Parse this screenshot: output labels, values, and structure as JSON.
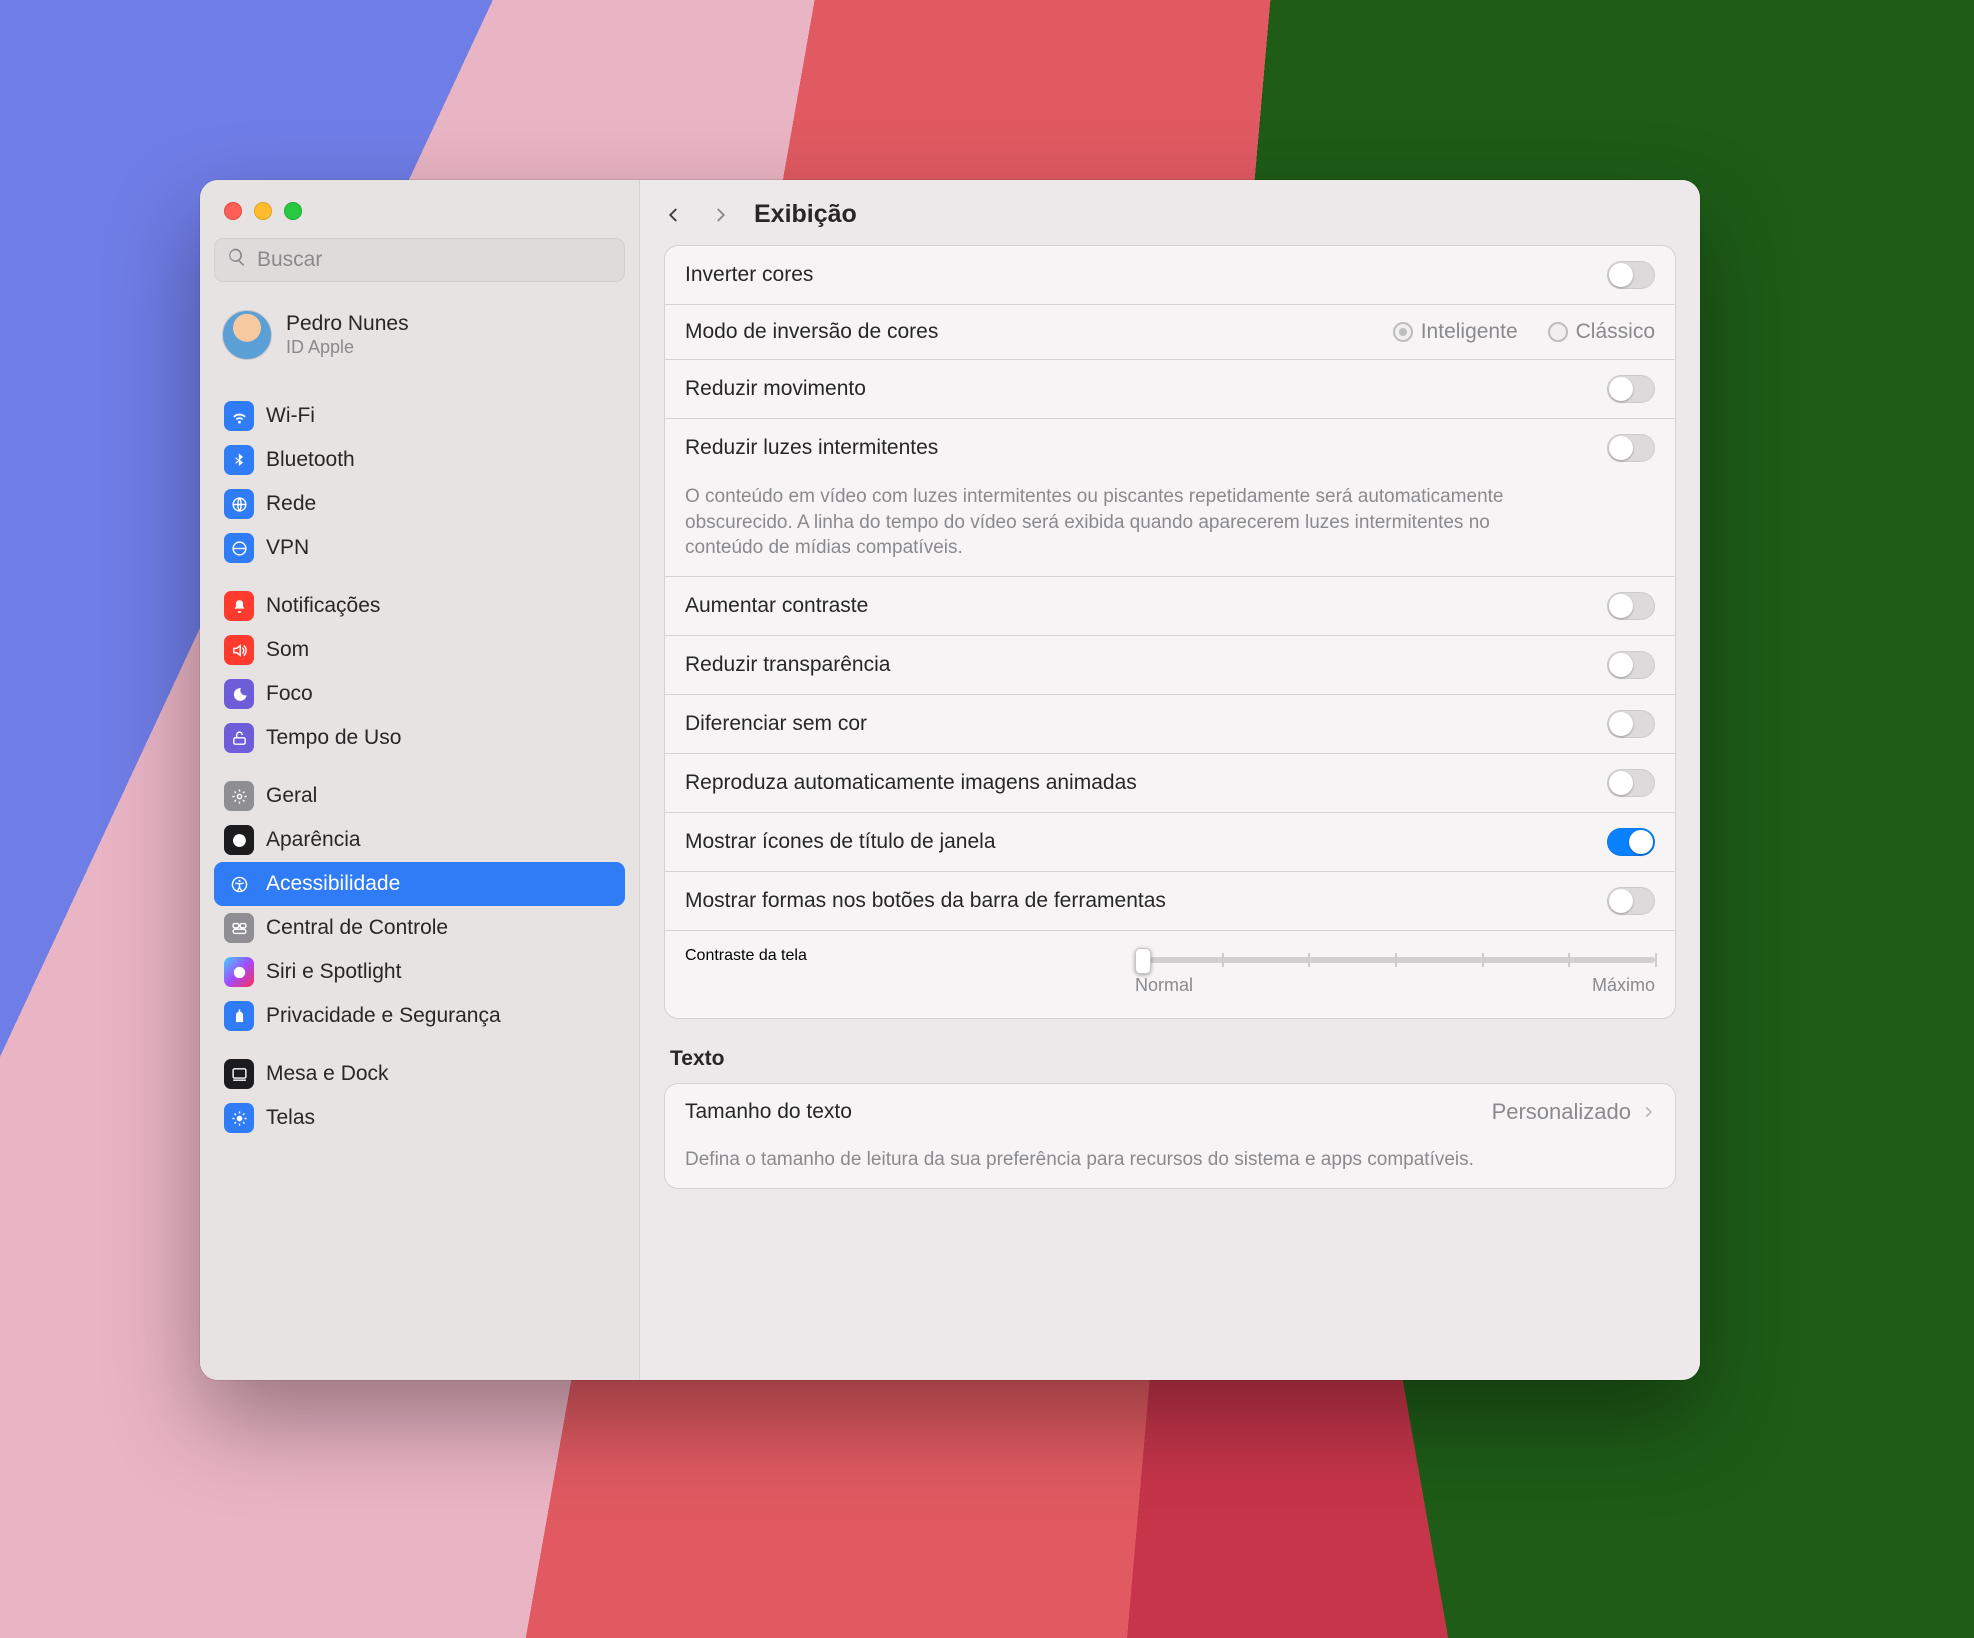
{
  "window": {
    "title": "Exibição"
  },
  "search": {
    "placeholder": "Buscar"
  },
  "user": {
    "name": "Pedro Nunes",
    "sub": "ID Apple"
  },
  "sidebar": {
    "groups": [
      [
        {
          "id": "wifi",
          "label": "Wi-Fi"
        },
        {
          "id": "bluetooth",
          "label": "Bluetooth"
        },
        {
          "id": "network",
          "label": "Rede"
        },
        {
          "id": "vpn",
          "label": "VPN"
        }
      ],
      [
        {
          "id": "notifications",
          "label": "Notificações"
        },
        {
          "id": "sound",
          "label": "Som"
        },
        {
          "id": "focus",
          "label": "Foco"
        },
        {
          "id": "screentime",
          "label": "Tempo de Uso"
        }
      ],
      [
        {
          "id": "general",
          "label": "Geral"
        },
        {
          "id": "appearance",
          "label": "Aparência"
        },
        {
          "id": "accessibility",
          "label": "Acessibilidade",
          "selected": true
        },
        {
          "id": "controlcenter",
          "label": "Central de Controle"
        },
        {
          "id": "siri",
          "label": "Siri e Spotlight"
        },
        {
          "id": "privacy",
          "label": "Privacidade e Segurança"
        }
      ],
      [
        {
          "id": "desktop",
          "label": "Mesa e Dock"
        },
        {
          "id": "displays",
          "label": "Telas"
        }
      ]
    ]
  },
  "settings": {
    "invertColors": {
      "label": "Inverter cores",
      "on": false
    },
    "inversionMode": {
      "label": "Modo de inversão de cores",
      "options": [
        {
          "id": "smart",
          "label": "Inteligente",
          "checked": true
        },
        {
          "id": "classic",
          "label": "Clássico",
          "checked": false
        }
      ]
    },
    "reduceMotion": {
      "label": "Reduzir movimento",
      "on": false
    },
    "reduceFlashing": {
      "label": "Reduzir luzes intermitentes",
      "desc": "O conteúdo em vídeo com luzes intermitentes ou piscantes repetidamente será automaticamente obscurecido. A linha do tempo do vídeo será exibida quando aparecerem luzes intermitentes no conteúdo de mídias compatíveis.",
      "on": false
    },
    "increaseContrast": {
      "label": "Aumentar contraste",
      "on": false
    },
    "reduceTransparency": {
      "label": "Reduzir transparência",
      "on": false
    },
    "diffWithoutColor": {
      "label": "Diferenciar sem cor",
      "on": false
    },
    "autoplayAnimated": {
      "label": "Reproduza automaticamente imagens animadas",
      "on": false
    },
    "showWindowTitleIcons": {
      "label": "Mostrar ícones de título de janela",
      "on": true
    },
    "showToolbarShapes": {
      "label": "Mostrar formas nos botões da barra de ferramentas",
      "on": false
    },
    "displayContrast": {
      "label": "Contraste da tela",
      "minLabel": "Normal",
      "maxLabel": "Máximo",
      "value": 0,
      "ticks": 7
    }
  },
  "textSection": {
    "header": "Texto",
    "textSize": {
      "label": "Tamanho do texto",
      "desc": "Defina o tamanho de leitura da sua preferência para recursos do sistema e apps compatíveis.",
      "value": "Personalizado"
    }
  }
}
